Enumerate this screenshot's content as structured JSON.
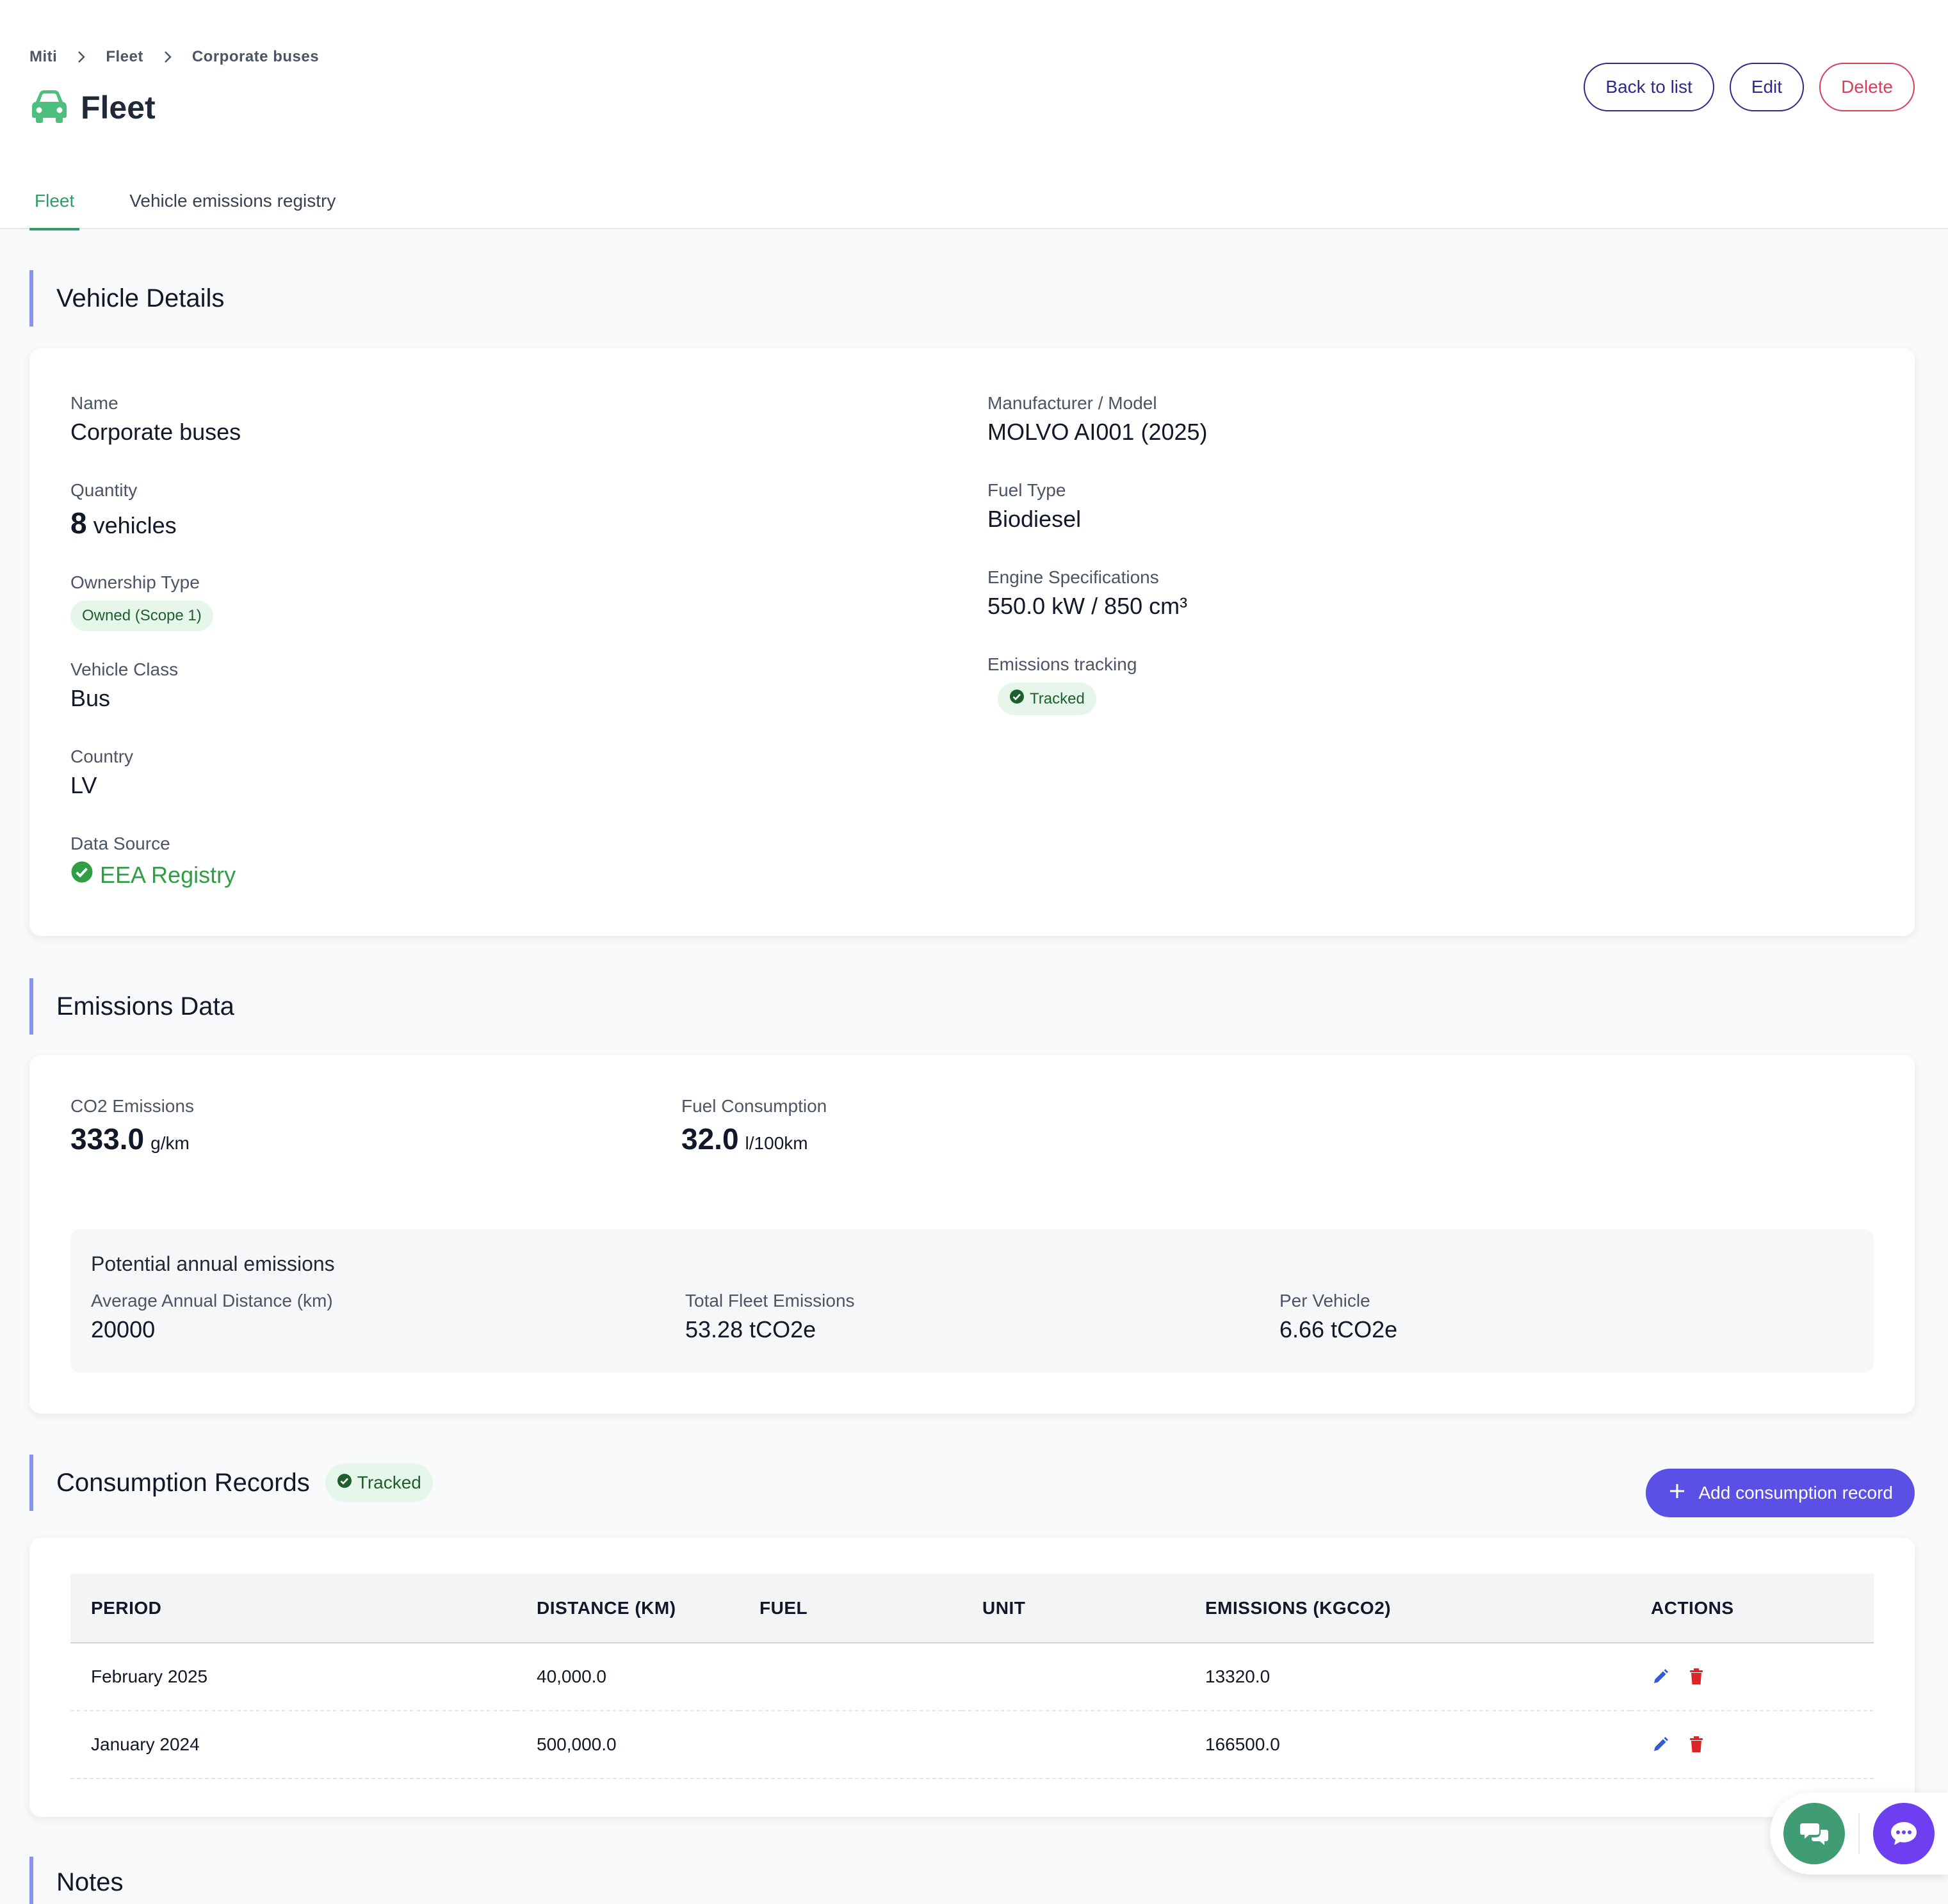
{
  "breadcrumb": [
    "Miti",
    "Fleet",
    "Corporate buses"
  ],
  "header": {
    "title": "Fleet",
    "icon": "car-icon"
  },
  "actions": {
    "back": "Back to list",
    "edit": "Edit",
    "delete": "Delete"
  },
  "tabs": [
    {
      "label": "Fleet",
      "active": true
    },
    {
      "label": "Vehicle emissions registry",
      "active": false
    }
  ],
  "vehicle_details": {
    "heading": "Vehicle Details",
    "name": {
      "label": "Name",
      "value": "Corporate buses"
    },
    "quantity": {
      "label": "Quantity",
      "number": "8",
      "unit": "vehicles"
    },
    "ownership": {
      "label": "Ownership Type",
      "badge": "Owned (Scope 1)"
    },
    "vehicle_class": {
      "label": "Vehicle Class",
      "value": "Bus"
    },
    "country": {
      "label": "Country",
      "value": "LV"
    },
    "data_source": {
      "label": "Data Source",
      "value": "EEA Registry"
    },
    "manufacturer": {
      "label": "Manufacturer / Model",
      "value": "MOLVO AI001 (2025)"
    },
    "fuel_type": {
      "label": "Fuel Type",
      "value": "Biodiesel"
    },
    "engine": {
      "label": "Engine Specifications",
      "value": "550.0 kW / 850 cm³"
    },
    "emissions_tracking": {
      "label": "Emissions tracking",
      "badge": "Tracked"
    }
  },
  "emissions_data": {
    "heading": "Emissions Data",
    "co2": {
      "label": "CO2 Emissions",
      "number": "333.0",
      "unit": "g/km"
    },
    "fuel": {
      "label": "Fuel Consumption",
      "number": "32.0",
      "unit": "l/100km"
    },
    "annual": {
      "title": "Potential annual emissions",
      "distance": {
        "label": "Average Annual Distance (km)",
        "value": "20000"
      },
      "total": {
        "label": "Total Fleet Emissions",
        "value": "53.28 tCO2e"
      },
      "per_vehicle": {
        "label": "Per Vehicle",
        "value": "6.66 tCO2e"
      }
    }
  },
  "consumption": {
    "heading": "Consumption Records",
    "badge": "Tracked",
    "add_label": "Add consumption record",
    "columns": [
      "PERIOD",
      "DISTANCE (KM)",
      "FUEL",
      "UNIT",
      "EMISSIONS (KGCO2)",
      "ACTIONS"
    ],
    "rows": [
      {
        "period": "February 2025",
        "distance": "40,000.0",
        "fuel": "",
        "unit": "",
        "emissions": "13320.0"
      },
      {
        "period": "January 2024",
        "distance": "500,000.0",
        "fuel": "",
        "unit": "",
        "emissions": "166500.0"
      }
    ]
  },
  "notes": {
    "heading": "Notes"
  },
  "colors": {
    "accent": "#2f9e66",
    "primary": "#5b50e6",
    "danger": "#dc3e5a",
    "section_bar": "#8b93f0"
  }
}
